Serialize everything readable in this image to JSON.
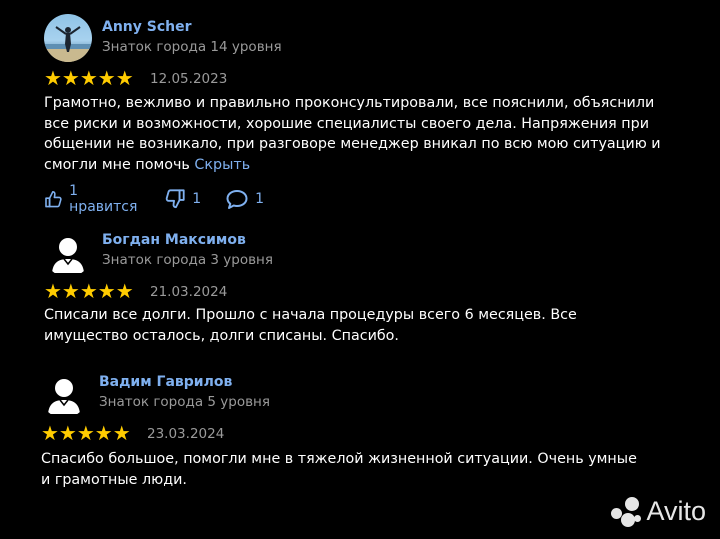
{
  "reviews": [
    {
      "name": "Anny Scher",
      "level": "Знаток города 14 уровня",
      "stars": "★★★★★",
      "date": "12.05.2023",
      "text": "Грамотно, вежливо и правильно проконсультировали, все пояснили, объяснили все риски и возможности, хорошие специалисты своего дела. Напряжения при общении не возникало, при разговоре менеджер вникал по всю мою ситуацию и смогли мне помочь",
      "more": "Скрыть",
      "likes": "1 нравится",
      "dislikes": "1",
      "comments": "1"
    },
    {
      "name": "Богдан Максимов",
      "level": "Знаток города 3 уровня",
      "stars": "★★★★★",
      "date": "21.03.2024",
      "text": "Списали все долги. Прошло с начала процедуры всего 6 месяцев. Все имущество осталось, долги списаны. Спасибо."
    },
    {
      "name": "Вадим Гаврилов",
      "level": "Знаток города 5 уровня",
      "stars": "★★★★★",
      "date": "23.03.2024",
      "text": "Спасибо большое, помогли мне в тяжелой жизненной ситуации. Очень умные и грамотные люди."
    }
  ],
  "watermark": "Avito",
  "colors": {
    "link": "#7fb0ef",
    "star": "#ffcc00",
    "muted": "#9a9a9a"
  }
}
